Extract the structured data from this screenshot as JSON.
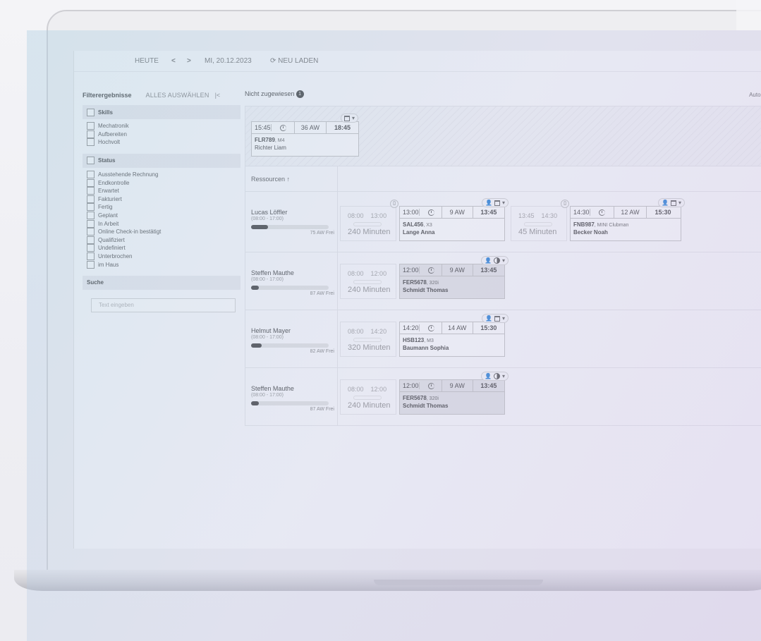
{
  "toolbar": {
    "today": "HEUTE",
    "prev": "<",
    "next": ">",
    "date": "MI, 20.12.2023",
    "reload": "⟳ NEU LADEN"
  },
  "sidebar": {
    "title": "Filterergebnisse",
    "select_all": "ALLES AUSWÄHLEN",
    "collapse": "|<",
    "skills": {
      "label": "Skills",
      "options": [
        "Mechatronik",
        "Aufbereiten",
        "Hochvolt"
      ]
    },
    "status": {
      "label": "Status",
      "options": [
        "Ausstehende Rechnung",
        "Endkontrolle",
        "Erwartet",
        "Fakturiert",
        "Fertig",
        "Geplant",
        "In Arbeit",
        "Online Check-in bestätigt",
        "Qualifiziert",
        "Undefiniert",
        "Unterbrochen",
        "im Haus"
      ]
    },
    "search": {
      "label": "Suche",
      "placeholder": "Text eingeben"
    }
  },
  "main": {
    "unassigned_label": "Nicht zugewiesen",
    "unassigned_count": "1",
    "automatik": "Automatik: A",
    "resources_label": "Ressourcen ↑",
    "unassigned_job": {
      "start": "15:45",
      "aw": "36 AW",
      "end": "18:45",
      "plate": "FLR789",
      "model": ", M4",
      "customer": "Richter Liam"
    },
    "rows": [
      {
        "name": "Lucas Löffler",
        "hours": "(08:00 - 17:00)",
        "load": 0.22,
        "free": "75 AW Frei",
        "free1": {
          "from": "08:00",
          "to": "13:00",
          "dur": "240 Minuten"
        },
        "job1": {
          "start": "13:00",
          "aw": "9 AW",
          "end": "13:45",
          "plate": "SAL456",
          "model": ", X3",
          "customer": "Lange Anna"
        },
        "free2": {
          "from": "13:45",
          "to": "14:30",
          "dur": "45 Minuten"
        },
        "job2": {
          "start": "14:30",
          "aw": "12 AW",
          "end": "15:30",
          "plate": "FNB987",
          "model": ", MINI Clubman",
          "customer": "Becker Noah"
        }
      },
      {
        "name": "Steffen Mauthe",
        "hours": "(08:00 - 17:00)",
        "load": 0.1,
        "free": "87 AW Frei",
        "free1": {
          "from": "08:00",
          "to": "12:00",
          "dur": "240 Minuten"
        },
        "job1": {
          "start": "12:00",
          "aw": "9 AW",
          "end": "13:45",
          "plate": "FER5678",
          "model": ", 320i",
          "customer": "Schmidt Thomas"
        }
      },
      {
        "name": "Helmut Mayer",
        "hours": "(08:00 - 17:00)",
        "load": 0.14,
        "free": "82 AW Frei",
        "free1": {
          "from": "08:00",
          "to": "14:20",
          "dur": "320 Minuten"
        },
        "job1": {
          "start": "14:20",
          "aw": "14 AW",
          "end": "15:30",
          "plate": "HSB123",
          "model": ", M3",
          "customer": "Baumann Sophia"
        }
      },
      {
        "name": "Steffen Mauthe",
        "hours": "(08:00 - 17:00)",
        "load": 0.1,
        "free": "87 AW Frei",
        "free1": {
          "from": "08:00",
          "to": "12:00",
          "dur": "240 Minuten"
        },
        "job1": {
          "start": "12:00",
          "aw": "9 AW",
          "end": "13:45",
          "plate": "FER5678",
          "model": ", 320i",
          "customer": "Schmidt Thomas"
        }
      }
    ]
  }
}
